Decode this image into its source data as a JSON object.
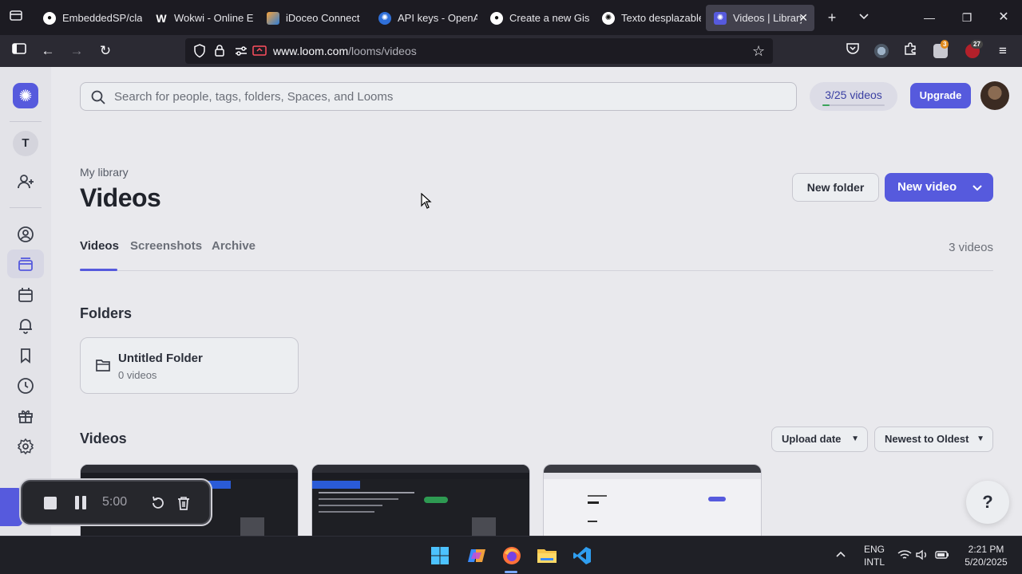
{
  "browser": {
    "tabs": [
      {
        "title": "EmbeddedSP/clas",
        "icon": "github-icon",
        "active": false
      },
      {
        "title": "Wokwi - Online ES",
        "icon": "wokwi-icon",
        "active": false
      },
      {
        "title": "iDoceo Connect",
        "icon": "idoceo-icon",
        "active": false
      },
      {
        "title": "API keys - OpenAI",
        "icon": "openai-icon",
        "active": false
      },
      {
        "title": "Create a new Gist",
        "icon": "github-icon",
        "active": false
      },
      {
        "title": "Texto desplazable",
        "icon": "openai-icon",
        "active": false
      },
      {
        "title": "Videos | Library",
        "icon": "loom-icon",
        "active": true
      }
    ],
    "url_host": "www.loom.com",
    "url_path": "/looms/videos",
    "extension_badges": {
      "first": "3",
      "second": "27"
    }
  },
  "header": {
    "search_placeholder": "Search for people, tags, folders, Spaces, and Looms",
    "quota_label": "3/25 videos",
    "quota_fraction": 0.12,
    "upgrade_label": "Upgrade"
  },
  "sidebar": {
    "workspace_initial": "T"
  },
  "main": {
    "breadcrumb": "My library",
    "title": "Videos",
    "new_folder_label": "New folder",
    "new_video_label": "New video",
    "tabs": [
      {
        "label": "Videos",
        "active": true
      },
      {
        "label": "Screenshots",
        "active": false
      },
      {
        "label": "Archive",
        "active": false
      }
    ],
    "video_count": "3 videos",
    "folders_heading": "Folders",
    "folders": [
      {
        "name": "Untitled Folder",
        "count": "0 videos"
      }
    ],
    "videos_heading": "Videos",
    "sort_field": "Upload date",
    "sort_order": "Newest to Oldest",
    "help_label": "?"
  },
  "recorder": {
    "time": "5:00"
  },
  "taskbar": {
    "lang": "ENG",
    "layout": "INTL",
    "time": "2:21 PM",
    "date": "5/20/2025"
  },
  "colors": {
    "accent": "#565add",
    "page_bg": "#e9e9ed",
    "browser_bg": "#1c1b22"
  }
}
